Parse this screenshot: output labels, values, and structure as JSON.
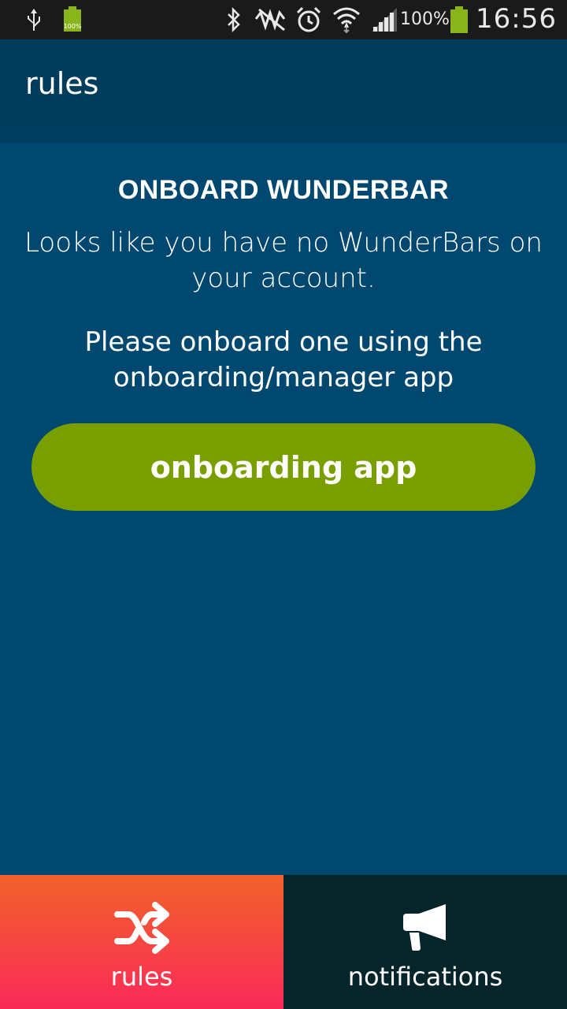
{
  "status_bar": {
    "battery_small_label": "100%",
    "battery_percent": "100%",
    "time": "16:56",
    "icons": [
      "usb-icon",
      "battery-icon",
      "bluetooth-icon",
      "mute-icon",
      "alarm-icon",
      "wifi-icon",
      "signal-icon",
      "battery-icon"
    ]
  },
  "app_bar": {
    "title": "rules"
  },
  "content": {
    "heading": "ONBOARD WUNDERBAR",
    "message1": "Looks like you have no WunderBars on your account.",
    "message2": "Please onboard one using the onboarding/manager app",
    "cta_label": "onboarding app"
  },
  "bottom_nav": {
    "tabs": [
      {
        "label": "rules",
        "icon": "shuffle-icon",
        "active": true
      },
      {
        "label": "notifications",
        "icon": "megaphone-icon",
        "active": false
      }
    ]
  },
  "colors": {
    "status_bar": "#1a1a1a",
    "app_bar": "#003c5c",
    "background": "#00486f",
    "cta": "#789e00",
    "rules_tab_top": "#f2622a",
    "rules_tab_bottom": "#fa2a58",
    "notifications_tab": "#05252b"
  }
}
